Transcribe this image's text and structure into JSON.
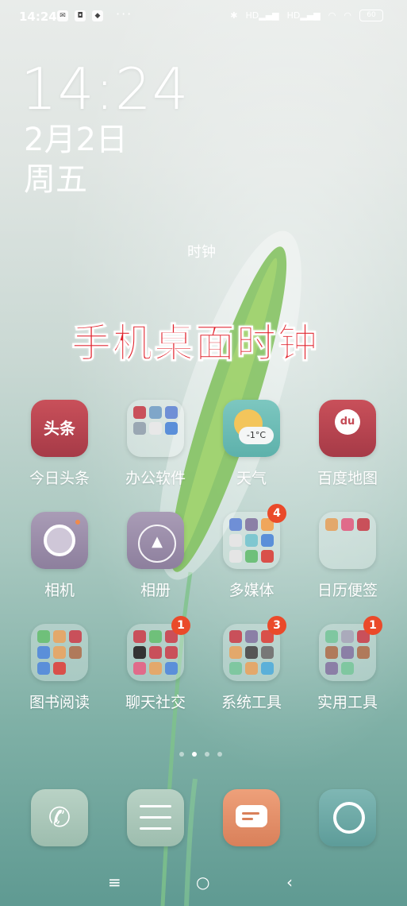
{
  "status_bar": {
    "time": "14:24",
    "left_icons": [
      "mail-icon",
      "notification-icon",
      "app-icon"
    ],
    "more": "···",
    "signal1": "HD",
    "signal2": "HD",
    "battery": "60"
  },
  "clock_widget": {
    "time": "14:24",
    "date": "2月2日",
    "weekday": "周五",
    "label": "时钟"
  },
  "caption": "手机桌面时钟",
  "apps": [
    {
      "label": "今日头条",
      "icon_text": "头条"
    },
    {
      "label": "办公软件",
      "badge": ""
    },
    {
      "label": "天气",
      "temp": "-1°C"
    },
    {
      "label": "百度地图",
      "icon_text": "du"
    },
    {
      "label": "相机"
    },
    {
      "label": "相册"
    },
    {
      "label": "多媒体",
      "badge": "4"
    },
    {
      "label": "日历便签"
    },
    {
      "label": "图书阅读"
    },
    {
      "label": "聊天社交",
      "badge": "1"
    },
    {
      "label": "系统工具",
      "badge": "3"
    },
    {
      "label": "实用工具",
      "badge": "1"
    }
  ],
  "page_indicator": {
    "pages": 4,
    "current": 2
  },
  "dock": [
    "phone-icon",
    "settings-icon",
    "messages-icon",
    "browser-icon"
  ],
  "nav": {
    "menu": "≡",
    "home": "○",
    "back": "‹"
  },
  "colors": {
    "accent_red": "#e0202a",
    "badge": "#ea4a2a"
  }
}
